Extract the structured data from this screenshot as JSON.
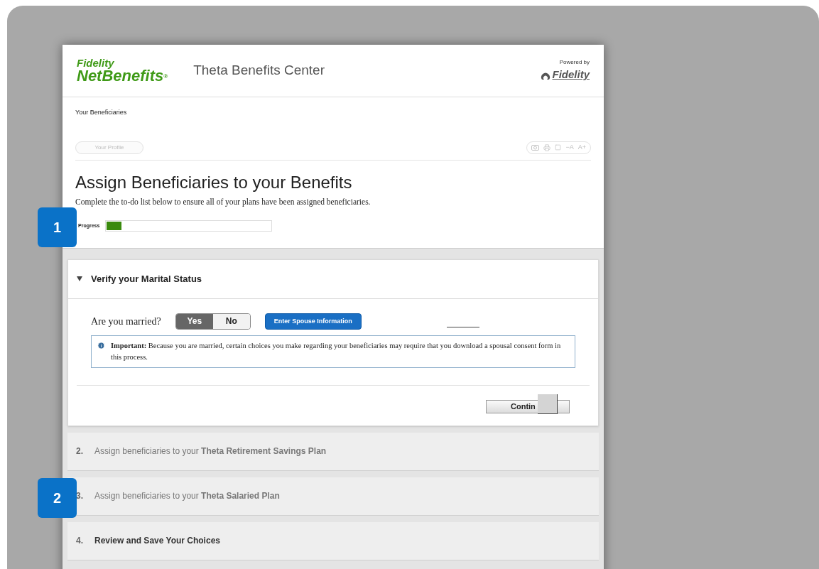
{
  "header": {
    "brand_top": "Fidelity",
    "brand_main": "NetBenefits",
    "brand_mark": "®",
    "site_title": "Theta Benefits Center",
    "powered_by": "Powered by",
    "partner": "Fidelity"
  },
  "breadcrumb": "Your Beneficiaries",
  "profile_button": "Your Profile",
  "text_size": [
    "−A",
    "A+"
  ],
  "title": "Assign Beneficiaries to your Benefits",
  "subtitle": "Complete the to-do list below to ensure all of your plans have been assigned beneficiaries.",
  "progress": {
    "label": "Progress",
    "level": 0.09
  },
  "callouts": [
    "1",
    "2"
  ],
  "steps": [
    {
      "kind": "open",
      "title": "Verify your Marital Status",
      "expanded": true,
      "question": "Are you married?",
      "options": [
        {
          "label": "Yes",
          "selected": true
        },
        {
          "label": "No",
          "selected": false
        }
      ],
      "action": "Enter Spouse Information",
      "notice": "**Important:** Because you are married, certain choices you make regarding your beneficiaries may require that you download a spousal consent form in this process.",
      "continue": "Contin"
    },
    {
      "kind": "plan",
      "number": "2.",
      "title": "Assign beneficiaries to your **Theta Retirement Savings Plan**"
    },
    {
      "kind": "plan",
      "number": "3.",
      "title": "Assign beneficiaries to your **Theta Salaried Plan**"
    },
    {
      "kind": "review",
      "number": "4.",
      "title": "Review and Save Your Choices"
    }
  ]
}
